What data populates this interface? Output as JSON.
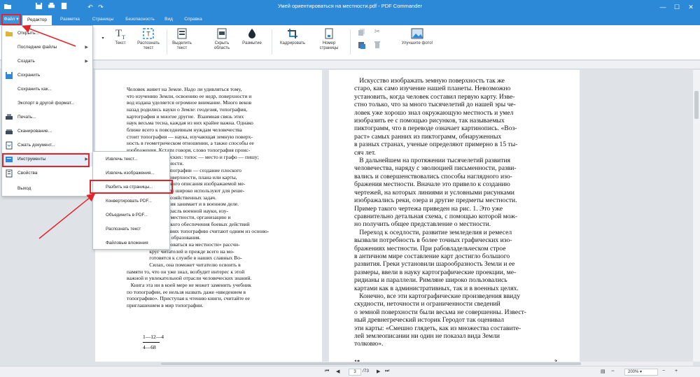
{
  "window": {
    "title": "Умей ориентироваться на местности.pdf - PDF Commander"
  },
  "tabs": [
    {
      "label": "Файл"
    },
    {
      "label": "Редактор"
    },
    {
      "label": "Разметка"
    },
    {
      "label": "Страницы"
    },
    {
      "label": "Безопасность"
    },
    {
      "label": "Вид"
    },
    {
      "label": "Справка"
    }
  ],
  "ribbon": {
    "text_label": "Текст",
    "recognize_label": "Распознать текст",
    "select_text_label": "Выделить текст",
    "hide_area_label": "Скрыть область",
    "blur_label": "Размытие",
    "crop_label": "Кадрировать",
    "page_number_label": "Номер страницы",
    "improve_photo_label": "Улучшите фото!"
  },
  "file_menu": {
    "items": [
      {
        "label": "Открыть..."
      },
      {
        "label": "Последние файлы"
      },
      {
        "label": "Создать"
      },
      {
        "label": "Сохранить"
      },
      {
        "label": "Сохранить как..."
      },
      {
        "label": "Экспорт в другой формат..."
      },
      {
        "label": "Печать..."
      },
      {
        "label": "Сканирование..."
      },
      {
        "label": "Сжать документ..."
      },
      {
        "label": "Инструменты"
      },
      {
        "label": "Свойства"
      },
      {
        "label": "Выход"
      }
    ]
  },
  "tools_submenu": {
    "items": [
      {
        "label": "Извлечь текст..."
      },
      {
        "label": "Извлечь изображения..."
      },
      {
        "label": "Разбить на страницы..."
      },
      {
        "label": "Конвертировать PDF..."
      },
      {
        "label": "Объединить в PDF..."
      },
      {
        "label": "Распознать текст"
      },
      {
        "label": "Файловые вложения"
      }
    ]
  },
  "document": {
    "left_page_text": "Человек живет на Земле. Надо ли удивляться тому,\nчто изучению Земли, освоению ее недр, поверхности и\nвод издана уделяется огромное внимание. Много веков\nназад родились науки о Земле: геодезия, топография,\nкартография и многие другие.  Взаимная связь этих\nнаук весьма тесна, каждая из них крайне важна. Однако\nближе всего к повседневным нуждам человечества\nстоит топография — наука, изучающая земную поверх-\nность в геометрическом отношении, а также способы ее\nизображения. Кстати говоря, слово топография проис-\nходит от двух греческих: топос — место и графо — пишу;\n                        местности.\n                 задача топографии — создание плоского\n                 земной поверхности, плана или карты,\n                 графического описания изображаемой ме-\n                 документы широко используют для реше-\n                 народнохозяйственных задач.\n                 топография занимает и в военном деле.\n                 — это отрасль военной науки, изу-\n                 свойства местности, организацию и\n                 графического обеспечения боевых действий\n                 вооружениях топографию считают одним из осново-\n                 военного образования.\n                 ориентироваться на местности» рассчи-\n                 круг читателей и прежде всего на мо-\n                 готовятся к службе в наших славных Во-\n                 Силах, она поможет читателю освоить в\nпамяти то, что он уже знал, возбудит интерес к этой\nважной и увлекательной отрасли человеческих знаний.\n   Книга эта ни в коей мере не может заменить учебник\nпо топографии, ее нельзя назвать даже «введением в\nтопографию». Приступая к чтению книги, считайте ее\nприглашением в мир топографии.",
    "right_page_text": "   Искусство изображать земную поверхность так же\nстаро, как само изучение нашей планеты. Невозможно\nустановить, когда человек составил первую карту. Изве-\nстно только, что за много тысячелетий до нашей эры че-\nловек уже хорошо знал окружающую местность и умел\nизобразить ее с помощью рисунков, так называемых\nпиктограмм, что в переводе означает картинопись. «Воз-\nраст» самых ранних из пиктограмм, обнаруженных\nв разных странах, ученые определяют примерно в 15 ты-\nсяч лет.\n   В дальнейшем на протяжении тысячелетий развития\nчеловечества, наряду с эволюцией письменности, разви-\nвались и совершенствовались способы наглядного изо-\nбражения местности. Вначале это привело к созданию\nчертежей, на которых линиями и условными рисунками\nизображались реки, озера и другие предметы местности.\nПример такого чертежа приведен на рис. 1. Это уже\nсравнительно детальная схема, с помощью которой мож-\nно получить общее представление о местности.\n   Переход к оседлости, развитие земледелия и ремесел\nвызвали потребность в более точных графических изо-\nбражениях местности. При рабовладельческом строе\nв античном мире составление карт достигло большого\nразвития. Греки установили шарообразность Земли и ее\nразмеры, ввели в науку картографические проекции, ме-\nридианы и параллели. Римляне широко пользовались\nкартами как в административных, так и в военных целях.\n   Конечно, все эти картографические произведения ввиду\nскудности, неточности и ограниченности сведений\nо земной поверхности были весьма не совершенны. Извест-\nный древнегреческий историк Геродот так оценивал\nэти карты: «Смешно глядеть, как из множества составите-\nлей землеописании ни один не показал вида Земли\nтолковю».",
    "left_signature_top": "1—12—4",
    "left_signature_bottom": "4—68",
    "right_footer_left": "1*",
    "right_footer_right": "3"
  },
  "status": {
    "current_page": "3",
    "total_pages": "/73",
    "zoom": "200%"
  },
  "colors": {
    "accent": "#2b89d8",
    "highlight": "#e3252b"
  }
}
